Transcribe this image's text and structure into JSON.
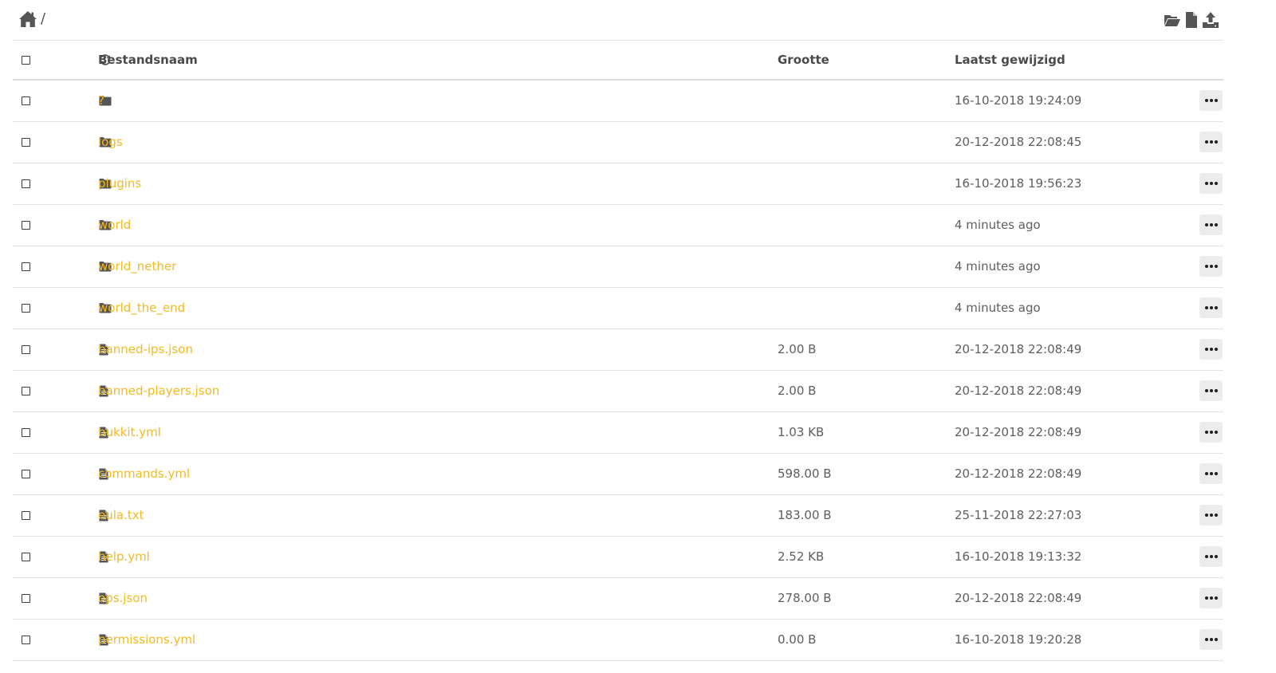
{
  "breadcrumb": {
    "separator": "/"
  },
  "columns": {
    "name": "Bestandsnaam",
    "size": "Grootte",
    "modified": "Laatst gewijzigd"
  },
  "icons": {
    "home": "home-icon",
    "new_folder": "folder-open-icon",
    "new_file": "file-icon",
    "upload": "upload-icon",
    "refresh": "refresh-icon",
    "folder": "folder-icon",
    "file": "file-text-icon",
    "more": "more-horizontal-icon"
  },
  "colors": {
    "link": "#f5ba21",
    "text": "#5e5e5e",
    "icon": "#555555"
  },
  "files": [
    {
      "type": "folder",
      "name": "?",
      "size": "",
      "modified": "16-10-2018 19:24:09"
    },
    {
      "type": "folder",
      "name": "logs",
      "size": "",
      "modified": "20-12-2018 22:08:45"
    },
    {
      "type": "folder",
      "name": "plugins",
      "size": "",
      "modified": "16-10-2018 19:56:23"
    },
    {
      "type": "folder",
      "name": "world",
      "size": "",
      "modified": "4 minutes ago"
    },
    {
      "type": "folder",
      "name": "world_nether",
      "size": "",
      "modified": "4 minutes ago"
    },
    {
      "type": "folder",
      "name": "world_the_end",
      "size": "",
      "modified": "4 minutes ago"
    },
    {
      "type": "file",
      "name": "banned-ips.json",
      "size": "2.00 B",
      "modified": "20-12-2018 22:08:49"
    },
    {
      "type": "file",
      "name": "banned-players.json",
      "size": "2.00 B",
      "modified": "20-12-2018 22:08:49"
    },
    {
      "type": "file",
      "name": "bukkit.yml",
      "size": "1.03 KB",
      "modified": "20-12-2018 22:08:49"
    },
    {
      "type": "file",
      "name": "commands.yml",
      "size": "598.00 B",
      "modified": "20-12-2018 22:08:49"
    },
    {
      "type": "file",
      "name": "eula.txt",
      "size": "183.00 B",
      "modified": "25-11-2018 22:27:03"
    },
    {
      "type": "file",
      "name": "help.yml",
      "size": "2.52 KB",
      "modified": "16-10-2018 19:13:32"
    },
    {
      "type": "file",
      "name": "ops.json",
      "size": "278.00 B",
      "modified": "20-12-2018 22:08:49"
    },
    {
      "type": "file",
      "name": "permissions.yml",
      "size": "0.00 B",
      "modified": "16-10-2018 19:20:28"
    }
  ]
}
